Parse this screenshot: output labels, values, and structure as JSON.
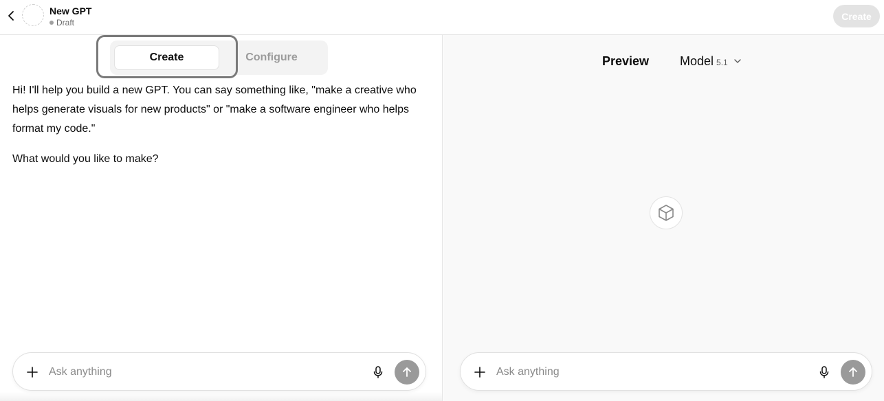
{
  "topbar": {
    "gpt_name": "New GPT",
    "status": "Draft",
    "create_button": "Create"
  },
  "tabs": {
    "create": "Create",
    "configure": "Configure",
    "active": "Create"
  },
  "chat": {
    "message_1": "Hi! I'll help you build a new GPT. You can say something like, \"make a creative who helps generate visuals for new products\" or \"make a software engineer who helps format my code.\"",
    "message_2": "What would you like to make?"
  },
  "left_composer": {
    "placeholder": "Ask anything",
    "value": ""
  },
  "preview": {
    "title": "Preview",
    "model_label": "Model",
    "model_version": "5.1"
  },
  "right_composer": {
    "placeholder": "Ask anything",
    "value": ""
  },
  "icons": {
    "back": "chevron-left-icon",
    "avatar": "dashed-circle",
    "plus": "plus-icon",
    "mic": "microphone-icon",
    "send": "arrow-up-icon",
    "chevron": "chevron-down-icon",
    "cube": "cube-icon"
  },
  "colors": {
    "send_button": "#9a9a9a",
    "disabled_create": "#e3e3e3",
    "highlight_border": "#7a7a7a"
  }
}
